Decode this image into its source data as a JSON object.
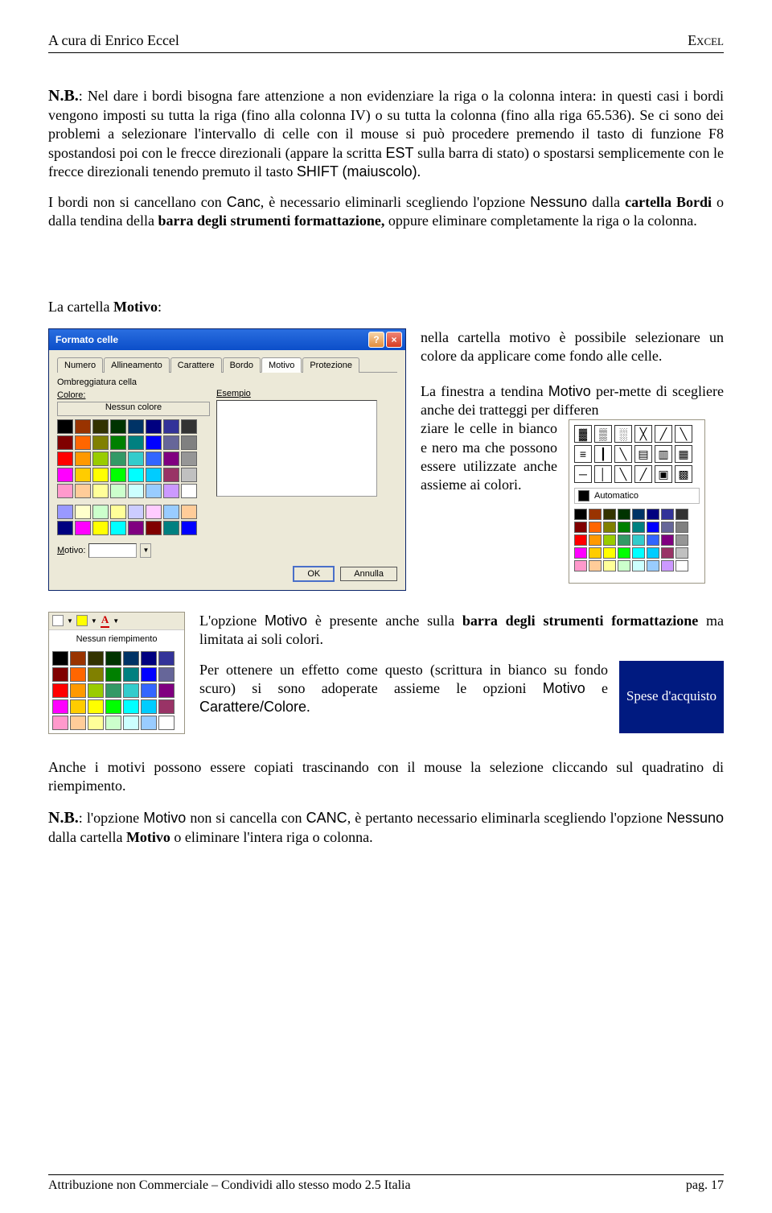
{
  "header": {
    "left": "A cura di Enrico Eccel",
    "right": "Excel"
  },
  "p1_nb": "N.B.",
  "p1": ": Nel dare i bordi bisogna fare attenzione a non evidenziare la riga o la colonna intera: in questi casi i bordi vengono imposti su tutta la riga (fino alla colonna IV) o su tutta la colonna (fino alla riga 65.536). Se ci sono dei problemi a selezionare l'intervallo di celle con il mouse si può procedere premendo il tasto di funzione F8 spostandosi poi con le frecce direzionali (appare la scritta ",
  "p1_est": "EST",
  "p1b": " sulla barra di stato) o spostarsi semplicemente con le frecce direzionali tenendo premuto il tasto ",
  "p1_shift": "SHIFT (maiuscolo)",
  "p1c": ".",
  "p2a": "I bordi non si cancellano con ",
  "p2_canc": "Canc",
  "p2b": ", è necessario eliminarli scegliendo l'opzione ",
  "p2_nessuno": "Nessuno",
  "p2c": " dalla ",
  "p2_cb": "cartella Bordi",
  "p2d": " o dalla tendina della ",
  "p2_barra": "barra degli strumenti formattazione,",
  "p2e": " oppure eliminare completamente la riga o la colonna.",
  "sec2_intro": "La cartella ",
  "sec2_b": "Motivo",
  "sec2_c": ":",
  "dlg": {
    "title": "Formato celle",
    "tabs": [
      "Numero",
      "Allineamento",
      "Carattere",
      "Bordo",
      "Motivo",
      "Protezione"
    ],
    "ombr": "Ombreggiatura cella",
    "colore": "Colore:",
    "nessun": "Nessun colore",
    "esempio": "Esempio",
    "motivo": "Motivo:",
    "ok": "OK",
    "annulla": "Annulla"
  },
  "txt_a": "nella cartella motivo è possibile selezionare un colore da applicare come fondo alle celle.",
  "txt_b1": "La finestra a tendina ",
  "txt_b_mot": "Motivo",
  "txt_b2": " per-mette di scegliere anche dei tratteggi per differen",
  "txt_c": "ziare le celle in bianco e nero ma che possono essere utilizzate anche assieme ai colori.",
  "auto": "Automatico",
  "row3": {
    "a1": "L'opzione ",
    "a_mot": "Motivo",
    "a2": " è presente anche sulla ",
    "a_barra": "barra degli strumenti formattazione",
    "a3": " ma limitata ai soli colori.",
    "b1": "Per ottenere un effetto come questo (scrittura in bianco su fondo scuro) si sono adoperate assieme le opzioni ",
    "b_mot": "Motivo",
    "b2": " e ",
    "b_car": "Carattere/Colore",
    "b3": "."
  },
  "nessun_riemp": "Nessun riempimento",
  "spese": "Spese d'acquisto",
  "p_anche": "Anche i motivi possono essere copiati trascinando con il mouse la selezione cliccando sul quadratino di riempimento.",
  "p5_nb": "N.B.",
  "p5a": ": l'opzione ",
  "p5_mot": "Motivo",
  "p5b": " non si cancella con ",
  "p5_canc": "CANC",
  "p5c": ", è pertanto necessario eliminarla scegliendo l'opzione ",
  "p5_ness": "Nessuno",
  "p5d": " dalla cartella ",
  "p5_cb": "Motivo",
  "p5e": " o eliminare l'intera riga o colonna.",
  "footer": {
    "left": "Attribuzione non Commerciale – Condividi  allo stesso modo 2.5 Italia",
    "right": "pag. 17"
  },
  "palette40": [
    "#000000",
    "#993300",
    "#333300",
    "#003300",
    "#003366",
    "#000080",
    "#333399",
    "#333333",
    "#800000",
    "#ff6600",
    "#808000",
    "#008000",
    "#008080",
    "#0000ff",
    "#666699",
    "#808080",
    "#ff0000",
    "#ff9900",
    "#99cc00",
    "#339966",
    "#33cccc",
    "#3366ff",
    "#800080",
    "#969696",
    "#ff00ff",
    "#ffcc00",
    "#ffff00",
    "#00ff00",
    "#00ffff",
    "#00ccff",
    "#993366",
    "#c0c0c0",
    "#ff99cc",
    "#ffcc99",
    "#ffff99",
    "#ccffcc",
    "#ccffff",
    "#99ccff",
    "#cc99ff",
    "#ffffff"
  ],
  "palette16": [
    "#9999ff",
    "#ffffcc",
    "#ccffcc",
    "#ffff99",
    "#ccccff",
    "#ffccff",
    "#99ccff",
    "#ffcc99",
    "#000080",
    "#ff00ff",
    "#ffff00",
    "#00ffff",
    "#800080",
    "#800000",
    "#008080",
    "#0000ff"
  ],
  "palette35": [
    "#000000",
    "#993300",
    "#333300",
    "#003300",
    "#003366",
    "#000080",
    "#333399",
    "#800000",
    "#ff6600",
    "#808000",
    "#008000",
    "#008080",
    "#0000ff",
    "#666699",
    "#ff0000",
    "#ff9900",
    "#99cc00",
    "#339966",
    "#33cccc",
    "#3366ff",
    "#800080",
    "#ff00ff",
    "#ffcc00",
    "#ffff00",
    "#00ff00",
    "#00ffff",
    "#00ccff",
    "#993366",
    "#ff99cc",
    "#ffcc99",
    "#ffff99",
    "#ccffcc",
    "#ccffff",
    "#99ccff",
    "#ffffff"
  ]
}
